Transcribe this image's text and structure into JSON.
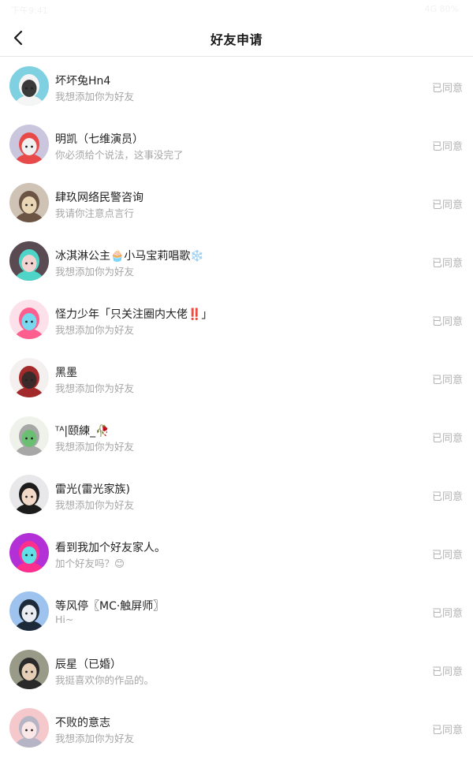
{
  "status_bar": {
    "time": "下午9:41",
    "right": "4G 80%"
  },
  "nav": {
    "back_icon": "chevron-left-icon",
    "title": "好友申请"
  },
  "requests": [
    {
      "name": "坏坏兔Hn4",
      "message": "我想添加你为好友",
      "status": "已同意",
      "avatar_colors": [
        "#7fd0e0",
        "#f5f5f5",
        "#3a3a3a"
      ]
    },
    {
      "name": "明凯（七维演员）",
      "message": "你必须给个说法，这事没完了",
      "status": "已同意",
      "avatar_colors": [
        "#c9c6de",
        "#e84a4a",
        "#f0f0f0"
      ]
    },
    {
      "name": "肆玖网络民警咨询",
      "message": "我请你注意点言行",
      "status": "已同意",
      "avatar_colors": [
        "#cfc3b6",
        "#6b5444",
        "#e9d6b4"
      ]
    },
    {
      "name": "冰淇淋公主🧁小马宝莉唱歌❄️",
      "message": "我想添加你为好友",
      "status": "已同意",
      "avatar_colors": [
        "#5a4a52",
        "#4fd5c8",
        "#f2d3cf"
      ]
    },
    {
      "name": "怪力少年「只关注圈内大佬‼️」",
      "message": "我想添加你为好友",
      "status": "已同意",
      "avatar_colors": [
        "#fde1ea",
        "#ff5f8f",
        "#7ad7f0"
      ]
    },
    {
      "name": "黑墨",
      "message": "我想添加你为好友",
      "status": "已同意",
      "avatar_colors": [
        "#f4f0ef",
        "#a32a2a",
        "#3b2a2a"
      ]
    },
    {
      "name": "ᵀᴬ|颐練_🥀",
      "message": "我想添加你为好友",
      "status": "已同意",
      "avatar_colors": [
        "#eef2ea",
        "#a7a7a7",
        "#6bbf73"
      ]
    },
    {
      "name": "雷光(雷光家族)",
      "message": "我想添加你为好友",
      "status": "已同意",
      "avatar_colors": [
        "#e8e8ea",
        "#1c1c1c",
        "#f2d8c6"
      ]
    },
    {
      "name": "看到我加个好友家人。",
      "message": "加个好友吗？😊",
      "status": "已同意",
      "avatar_colors": [
        "#b32fd6",
        "#ff2f8e",
        "#62e0e8"
      ]
    },
    {
      "name": "等风停〖MC·触屏师〗",
      "message": "Hi~",
      "status": "已同意",
      "avatar_colors": [
        "#9fc3ef",
        "#1d2a3a",
        "#e9edf2"
      ]
    },
    {
      "name": "辰星（已婚）",
      "message": "我挺喜欢你的作品的。",
      "status": "已同意",
      "avatar_colors": [
        "#9a9a88",
        "#2a2a2a",
        "#e6cdb6"
      ]
    },
    {
      "name": "不败的意志",
      "message": "我想添加你为好友",
      "status": "已同意",
      "avatar_colors": [
        "#f5c8cc",
        "#b5b5c5",
        "#fbe7e6"
      ]
    }
  ]
}
